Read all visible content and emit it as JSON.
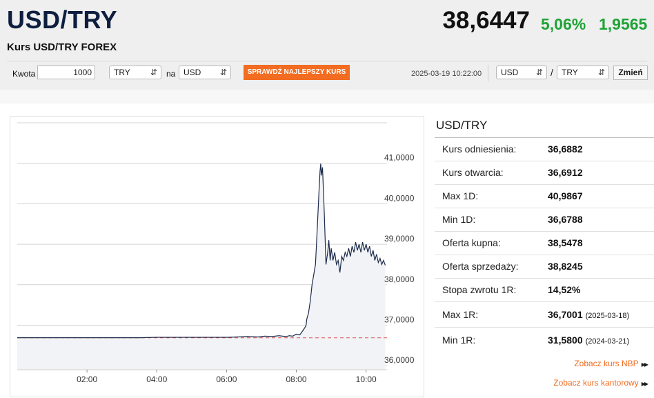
{
  "header": {
    "pair": "USD/TRY",
    "subtitle": "Kurs USD/TRY FOREX",
    "price": "38,6447",
    "change_pct": "5,06%",
    "change_abs": "1,9565",
    "change_color": "#1ea335"
  },
  "converter": {
    "amount_label": "Kwota",
    "amount_value": "1000",
    "from_currency": "TRY",
    "to_label": "na",
    "to_currency": "USD",
    "best_rate_button": "SPRAWDŹ NAJLEPSZY KURS",
    "datetime": "2025-03-19 10:22:00",
    "pair_base": "USD",
    "pair_separator": "/",
    "pair_quote": "TRY",
    "change_button": "Zmień",
    "accent_color": "#f26c21"
  },
  "panel": {
    "title": "USD/TRY",
    "rows": [
      {
        "label": "Kurs odniesienia:",
        "value": "36,6882",
        "date": ""
      },
      {
        "label": "Kurs otwarcia:",
        "value": "36,6912",
        "date": ""
      },
      {
        "label": "Max 1D:",
        "value": "40,9867",
        "date": ""
      },
      {
        "label": "Min 1D:",
        "value": "36,6788",
        "date": ""
      },
      {
        "label": "Oferta kupna:",
        "value": "38,5478",
        "date": ""
      },
      {
        "label": "Oferta sprzedaży:",
        "value": "38,8245",
        "date": ""
      },
      {
        "label": "Stopa zwrotu 1R:",
        "value": "14,52%",
        "date": ""
      },
      {
        "label": "Max 1R:",
        "value": "36,7001",
        "date": "(2025-03-18)"
      },
      {
        "label": "Min 1R:",
        "value": "31,5800",
        "date": "(2024-03-21)"
      }
    ],
    "links": [
      "Zobacz kurs NBP",
      "Zobacz kurs kantorowy"
    ]
  },
  "chart_data": {
    "type": "area",
    "title": "",
    "xlabel": "",
    "ylabel": "",
    "x_ticks": [
      "02:00",
      "04:00",
      "06:00",
      "08:00",
      "10:00"
    ],
    "x_tick_values": [
      2,
      4,
      6,
      8,
      10
    ],
    "y_ticks": [
      "36,0000",
      "37,0000",
      "38,0000",
      "39,0000",
      "40,0000",
      "41,0000"
    ],
    "y_tick_values": [
      36,
      37,
      38,
      39,
      40,
      41
    ],
    "xlim": [
      0,
      10.6
    ],
    "ylim": [
      35.9,
      42.0
    ],
    "reference_line": 36.6882,
    "reference_color": "#e05050",
    "line_color": "#1c2b4a",
    "area_color": "#f1f3f6",
    "grid": true,
    "series": [
      {
        "points": [
          [
            0,
            36.69
          ],
          [
            0.5,
            36.69
          ],
          [
            1,
            36.69
          ],
          [
            1.5,
            36.69
          ],
          [
            2,
            36.69
          ],
          [
            2.5,
            36.69
          ],
          [
            3,
            36.69
          ],
          [
            3.5,
            36.69
          ],
          [
            4,
            36.7
          ],
          [
            4.5,
            36.7
          ],
          [
            5,
            36.7
          ],
          [
            5.5,
            36.7
          ],
          [
            6,
            36.7
          ],
          [
            6.3,
            36.71
          ],
          [
            6.6,
            36.72
          ],
          [
            6.9,
            36.71
          ],
          [
            7.1,
            36.73
          ],
          [
            7.3,
            36.72
          ],
          [
            7.5,
            36.74
          ],
          [
            7.7,
            36.72
          ],
          [
            7.8,
            36.74
          ],
          [
            7.9,
            36.73
          ],
          [
            8.0,
            36.78
          ],
          [
            8.1,
            36.76
          ],
          [
            8.15,
            36.82
          ],
          [
            8.2,
            36.88
          ],
          [
            8.25,
            36.95
          ],
          [
            8.28,
            37.0
          ],
          [
            8.3,
            37.15
          ],
          [
            8.35,
            37.3
          ],
          [
            8.4,
            37.6
          ],
          [
            8.45,
            38.0
          ],
          [
            8.5,
            38.25
          ],
          [
            8.55,
            38.5
          ],
          [
            8.6,
            39.4
          ],
          [
            8.65,
            40.3
          ],
          [
            8.68,
            40.8
          ],
          [
            8.7,
            40.99
          ],
          [
            8.72,
            40.7
          ],
          [
            8.75,
            40.9
          ],
          [
            8.8,
            39.8
          ],
          [
            8.85,
            38.5
          ],
          [
            8.9,
            38.8
          ],
          [
            8.93,
            39.1
          ],
          [
            8.97,
            38.6
          ],
          [
            9.0,
            38.9
          ],
          [
            9.05,
            38.6
          ],
          [
            9.1,
            38.8
          ],
          [
            9.15,
            38.5
          ],
          [
            9.2,
            38.6
          ],
          [
            9.25,
            38.3
          ],
          [
            9.3,
            38.7
          ],
          [
            9.35,
            38.6
          ],
          [
            9.4,
            38.8
          ],
          [
            9.45,
            38.7
          ],
          [
            9.5,
            38.9
          ],
          [
            9.55,
            38.7
          ],
          [
            9.6,
            38.95
          ],
          [
            9.65,
            38.8
          ],
          [
            9.7,
            39.05
          ],
          [
            9.75,
            38.85
          ],
          [
            9.8,
            39.0
          ],
          [
            9.85,
            38.8
          ],
          [
            9.9,
            39.05
          ],
          [
            9.95,
            38.85
          ],
          [
            10.0,
            39.0
          ],
          [
            10.05,
            38.8
          ],
          [
            10.1,
            38.95
          ],
          [
            10.15,
            38.7
          ],
          [
            10.2,
            38.85
          ],
          [
            10.25,
            38.6
          ],
          [
            10.3,
            38.75
          ],
          [
            10.35,
            38.55
          ],
          [
            10.4,
            38.65
          ],
          [
            10.45,
            38.5
          ],
          [
            10.5,
            38.6
          ],
          [
            10.55,
            38.48
          ]
        ]
      }
    ]
  }
}
